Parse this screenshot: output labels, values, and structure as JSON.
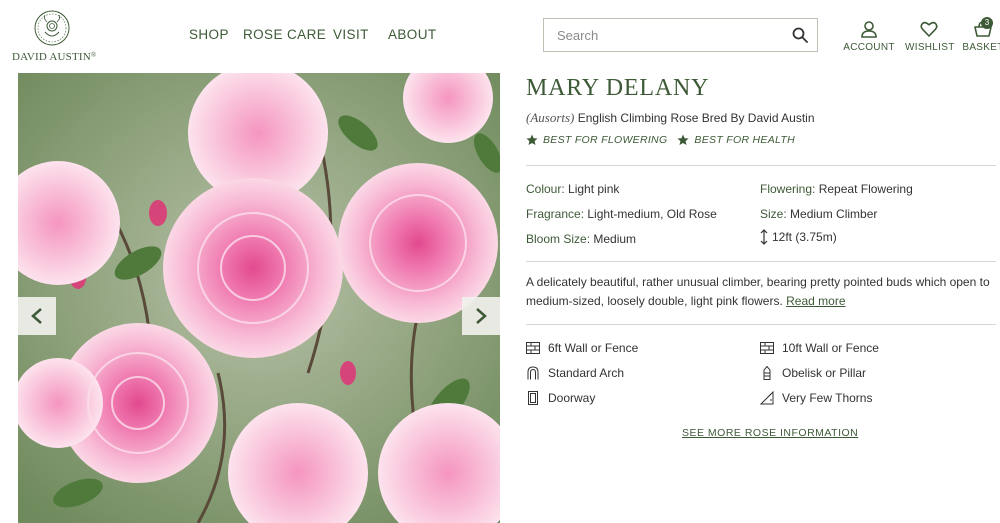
{
  "brand": {
    "logo_text": "DAVID AUSTIN",
    "logo_mark": "®"
  },
  "nav": {
    "shop": "SHOP",
    "rose_care": "ROSE CARE",
    "visit": "VISIT",
    "about": "ABOUT"
  },
  "search": {
    "placeholder": "Search",
    "value": ""
  },
  "header_actions": {
    "account": "ACCOUNT",
    "wishlist": "WISHLIST",
    "basket": "BASKET",
    "basket_count": "3"
  },
  "product": {
    "name": "MARY DELANY",
    "code": "(Ausorts)",
    "subtitle": "English Climbing Rose Bred By David Austin",
    "tags": [
      "BEST FOR FLOWERING",
      "BEST FOR HEALTH"
    ],
    "specs": {
      "colour_label": "Colour:",
      "colour": "Light pink",
      "flowering_label": "Flowering:",
      "flowering": "Repeat Flowering",
      "fragrance_label": "Fragrance:",
      "fragrance": "Light-medium, Old Rose",
      "size_label": "Size:",
      "size": "Medium Climber",
      "bloom_label": "Bloom Size:",
      "bloom": "Medium",
      "height": "12ft (3.75m)"
    },
    "description": "A delicately beautiful, rather unusual climber, bearing pretty pointed buds which open to medium-sized, loosely double, light pink flowers.",
    "read_more": "Read more",
    "uses": [
      "6ft Wall or Fence",
      "10ft Wall or Fence",
      "Standard Arch",
      "Obelisk or Pillar",
      "Doorway",
      "Very Few Thorns"
    ],
    "see_more": "SEE MORE ROSE INFORMATION"
  },
  "colors": {
    "brand_green": "#3d5a37",
    "rose_pink": "#f28cb8",
    "divider": "#d6d6d6"
  }
}
